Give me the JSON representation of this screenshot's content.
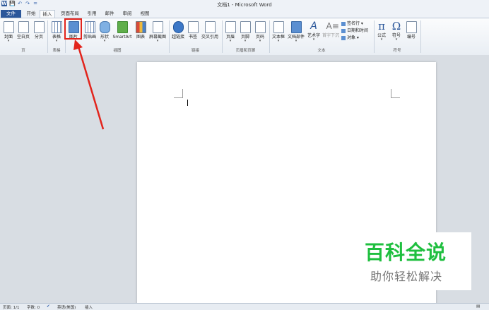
{
  "window": {
    "title": "文档1 - Microsoft Word"
  },
  "qat": [
    "W",
    "💾",
    "↶",
    "↷",
    "="
  ],
  "tabs": [
    "文件",
    "开始",
    "插入",
    "页面布局",
    "引用",
    "邮件",
    "审阅",
    "视图"
  ],
  "ribbon": {
    "buttons": [
      "封面",
      "空白页",
      "分页",
      "表格",
      "图片",
      "剪贴画",
      "形状",
      "SmartArt",
      "图表",
      "屏幕截图",
      "超链接",
      "书签",
      "交叉引用",
      "页眉",
      "页脚",
      "页码",
      "文本框",
      "文档部件",
      "艺术字",
      "首字下沉",
      "公式",
      "符号",
      "编号"
    ],
    "small": [
      "签名行 ▾",
      "日期和时间",
      "对象 ▾"
    ],
    "groups": [
      "页",
      "表格",
      "插图",
      "链接",
      "页眉和页脚",
      "文本",
      "符号"
    ]
  },
  "status": {
    "page": "页面: 1/1",
    "words": "字数: 0",
    "lang": "英语(美国)",
    "mode": "插入"
  },
  "watermark": {
    "title": "百科全说",
    "subtitle": "助你轻松解决"
  },
  "colors": {
    "accent": "#2b579a",
    "highlight": "#e2241c",
    "watermark": "#1fbf3f"
  }
}
